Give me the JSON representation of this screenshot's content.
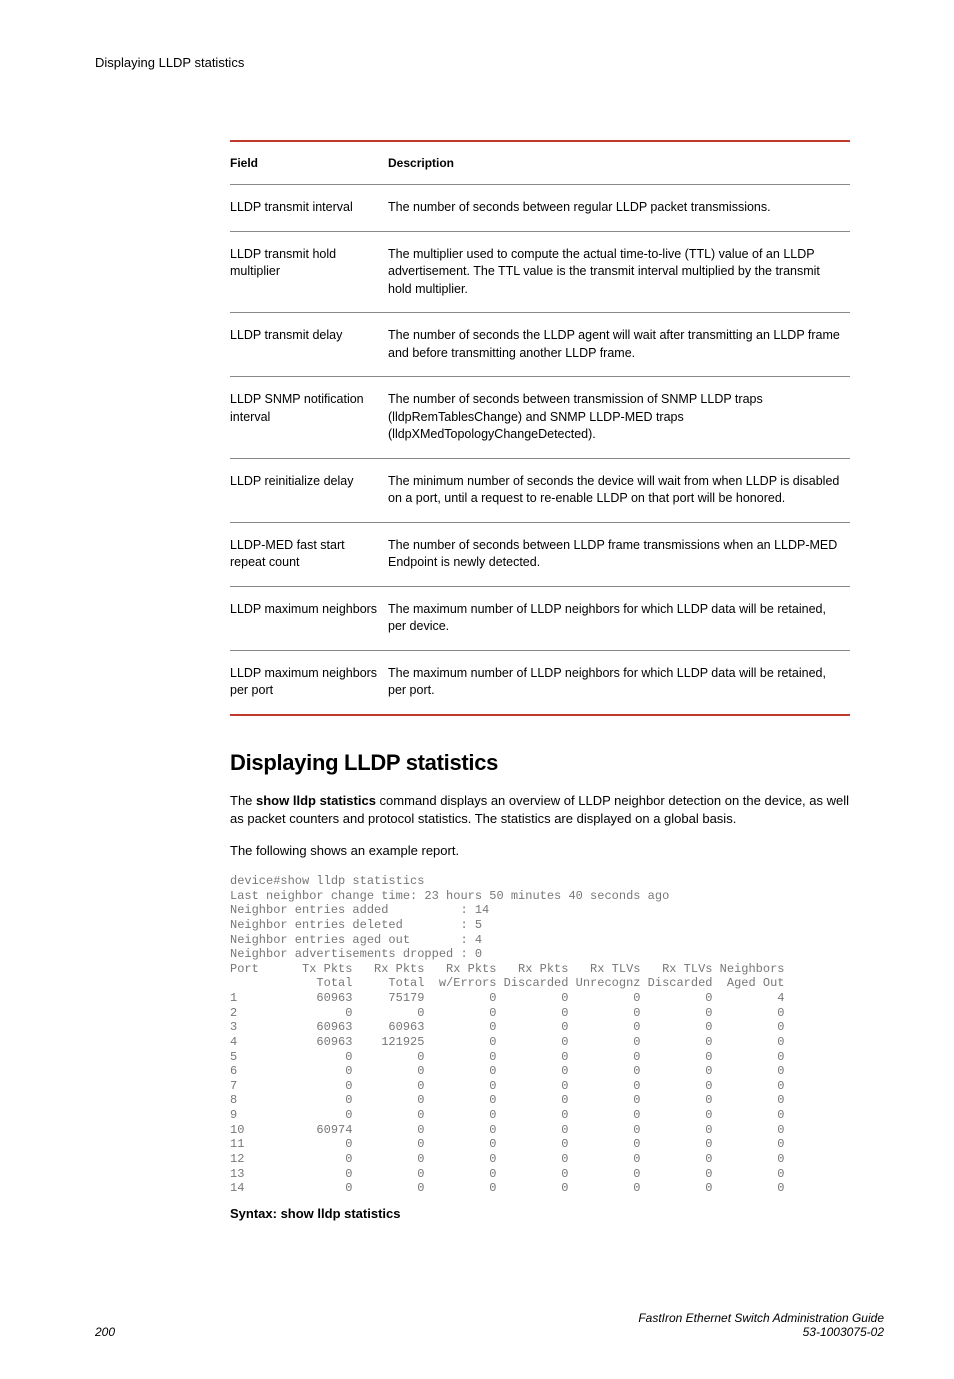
{
  "header": {
    "title": "Displaying LLDP statistics"
  },
  "table": {
    "head": {
      "field": "Field",
      "desc": "Description"
    },
    "rows": [
      {
        "field": "LLDP transmit interval",
        "desc": "The number of seconds between regular LLDP packet transmissions."
      },
      {
        "field": "LLDP transmit hold multiplier",
        "desc": "The multiplier used to compute the actual time-to-live (TTL) value of an LLDP advertisement. The TTL value is the transmit interval multiplied by the transmit hold multiplier."
      },
      {
        "field": "LLDP transmit delay",
        "desc": "The number of seconds the LLDP agent will wait after transmitting an LLDP frame and before transmitting another LLDP frame."
      },
      {
        "field": "LLDP SNMP notification interval",
        "desc": "The number of seconds between transmission of SNMP LLDP traps (lldpRemTablesChange) and SNMP LLDP-MED traps (lldpXMedTopologyChangeDetected)."
      },
      {
        "field": "LLDP reinitialize delay",
        "desc": "The minimum number of seconds the device will wait from when LLDP is disabled on a port, until a request to re-enable LLDP on that port will be honored."
      },
      {
        "field": "LLDP-MED fast start repeat count",
        "desc": "The number of seconds between LLDP frame transmissions when an LLDP-MED Endpoint is newly detected."
      },
      {
        "field": "LLDP maximum neighbors",
        "desc": "The maximum number of LLDP neighbors for which LLDP data will be retained, per device."
      },
      {
        "field": "LLDP maximum neighbors per port",
        "desc": "The maximum number of LLDP neighbors for which LLDP data will be retained, per port."
      }
    ]
  },
  "section": {
    "heading": "Displaying LLDP statistics",
    "para1_pre": "The ",
    "para1_cmd": "show lldp statistics",
    "para1_post": " command displays an overview of LLDP neighbor detection on the device, as well as packet counters and protocol statistics. The statistics are displayed on a global basis.",
    "para2": "The following shows an example report.",
    "code": "device#show lldp statistics\nLast neighbor change time: 23 hours 50 minutes 40 seconds ago\nNeighbor entries added          : 14\nNeighbor entries deleted        : 5\nNeighbor entries aged out       : 4\nNeighbor advertisements dropped : 0\nPort      Tx Pkts   Rx Pkts   Rx Pkts   Rx Pkts   Rx TLVs   Rx TLVs Neighbors\n            Total     Total  w/Errors Discarded Unrecognz Discarded  Aged Out\n1           60963     75179         0         0         0         0         4\n2               0         0         0         0         0         0         0\n3           60963     60963         0         0         0         0         0\n4           60963    121925         0         0         0         0         0\n5               0         0         0         0         0         0         0\n6               0         0         0         0         0         0         0\n7               0         0         0         0         0         0         0\n8               0         0         0         0         0         0         0\n9               0         0         0         0         0         0         0\n10          60974         0         0         0         0         0         0\n11              0         0         0         0         0         0         0\n12              0         0         0         0         0         0         0\n13              0         0         0         0         0         0         0\n14              0         0         0         0         0         0         0",
    "syntax": "Syntax: show lldp statistics"
  },
  "footer": {
    "page": "200",
    "title": "FastIron Ethernet Switch Administration Guide",
    "docnum": "53-1003075-02"
  }
}
